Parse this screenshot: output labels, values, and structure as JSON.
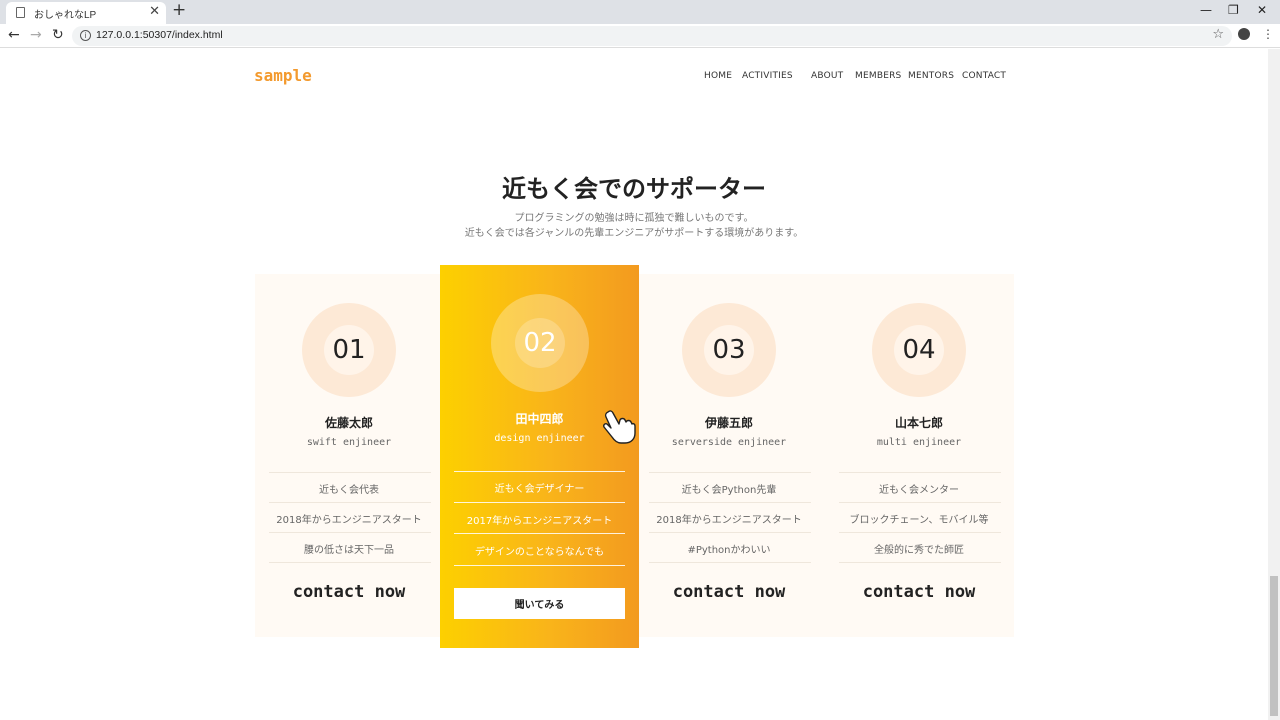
{
  "browser": {
    "tab_title": "おしゃれなLP",
    "tab_close": "✕",
    "new_tab": "+",
    "url": "127.0.0.1:50307/index.html",
    "controls": {
      "minimize": "—",
      "restore": "❐",
      "close": "✕"
    },
    "nav": {
      "back": "←",
      "forward": "→",
      "reload": "↻"
    },
    "star": "☆",
    "menu": "⋮",
    "info": "i"
  },
  "header": {
    "logo": "sample",
    "nav": [
      "HOME",
      "ACTIVITIES",
      "ABOUT",
      "MEMBERS",
      "MENTORS",
      "CONTACT"
    ]
  },
  "section": {
    "title": "近もく会でのサポーター",
    "desc_line1": "プログラミングの勉強は時に孤独で難しいものです。",
    "desc_line2": "近もく会では各ジャンルの先輩エンジニアがサポートする環境があります。"
  },
  "cards": [
    {
      "num": "01",
      "name": "佐藤太郎",
      "role": "swift enjineer",
      "items": [
        "近もく会代表",
        "2018年からエンジニアスタート",
        "腰の低さは天下一品"
      ],
      "cta": "contact now"
    },
    {
      "num": "02",
      "name": "田中四郎",
      "role": "design enjineer",
      "items": [
        "近もく会デザイナー",
        "2017年からエンジニアスタート",
        "デザインのことならなんでも"
      ],
      "cta": "聞いてみる"
    },
    {
      "num": "03",
      "name": "伊藤五郎",
      "role": "serverside enjineer",
      "items": [
        "近もく会Python先輩",
        "2018年からエンジニアスタート",
        "#Pythonかわいい"
      ],
      "cta": "contact now"
    },
    {
      "num": "04",
      "name": "山本七郎",
      "role": "multi enjineer",
      "items": [
        "近もく会メンター",
        "ブロックチェーン、モバイル等",
        "全般的に秀でた師匠"
      ],
      "cta": "contact now"
    }
  ],
  "colors": {
    "accent": "#f39a2e",
    "card_bg": "#fffaf4",
    "featured_start": "#fdd000",
    "featured_end": "#f39a1f"
  },
  "icons": {
    "cursor": "hand-pointer-icon"
  }
}
